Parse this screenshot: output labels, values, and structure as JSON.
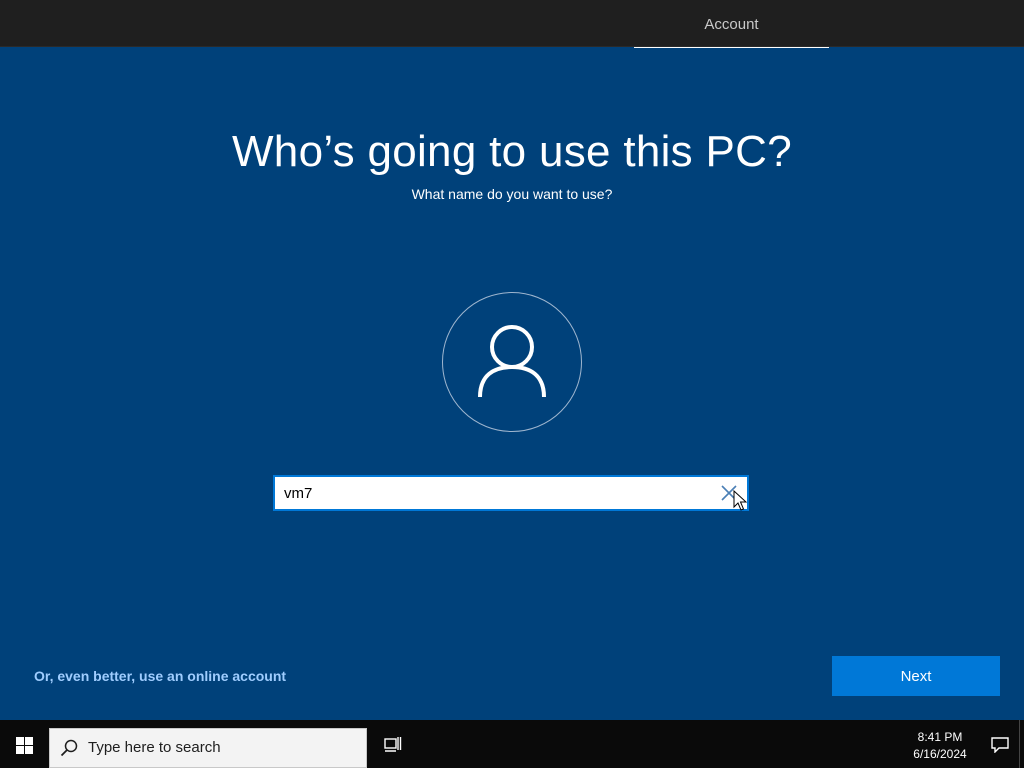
{
  "header": {
    "tab_account": "Account"
  },
  "main": {
    "title": "Who’s going to use this PC?",
    "subtitle": "What name do you want to use?",
    "name_input_value": "vm7",
    "online_account_link": "Or, even better, use an online account",
    "next_label": "Next"
  },
  "taskbar": {
    "search_placeholder": "Type here to search",
    "time": "8:41 PM",
    "date": "6/16/2024"
  },
  "icons": {
    "avatar": "user-icon",
    "clear": "close-icon",
    "start": "windows-logo-icon",
    "search": "search-icon",
    "taskview": "task-view-icon",
    "notifications": "notification-icon",
    "pointer": "mouse-cursor-icon"
  },
  "colors": {
    "background": "#00417a",
    "accent": "#0078d7",
    "link": "#9fcdff",
    "topbar": "#1f1f1f",
    "taskbar": "#0a0a0a"
  }
}
